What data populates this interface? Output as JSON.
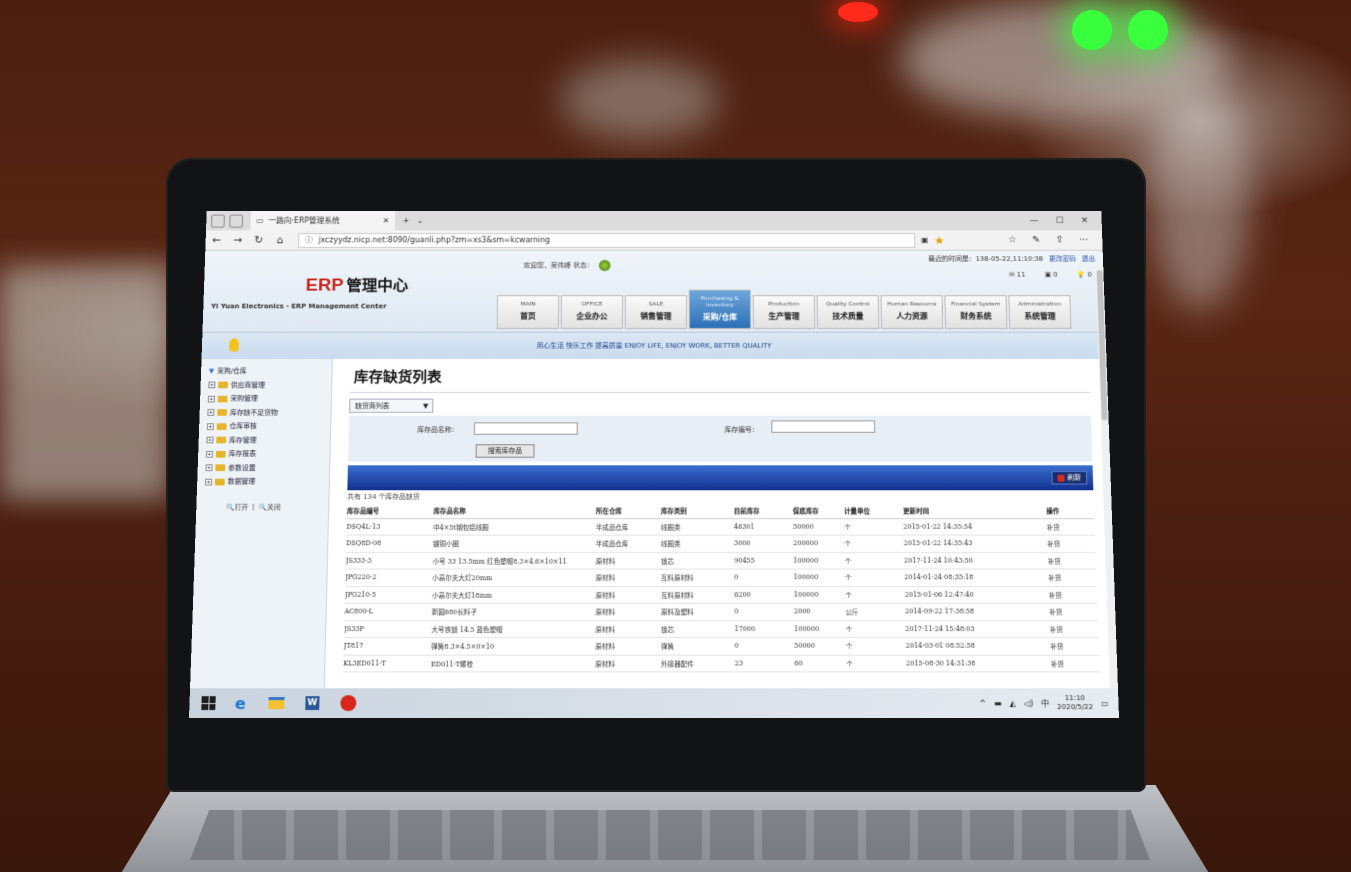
{
  "browser": {
    "tab_title": "一路向·ERP管理系统",
    "tab_close": "✕",
    "new_tab": "+",
    "url": "jxczyydz.nicp.net:8090/guanli.php?zm=xs3&sm=kcwarning"
  },
  "header": {
    "logo_main": "ERP",
    "logo_cn": "管理中心",
    "logo_sub": "Yi Yuan Electronics - ERP Management Center",
    "welcome": "欢迎您，吴伟峰 状态：",
    "login_time": "最近的时间是：138-05-22,11:10:38",
    "link1": "更改密码",
    "link2": "退出",
    "msg1": "11",
    "msg2": "0",
    "msg3": "0"
  },
  "menu": [
    {
      "en": "MAIN",
      "cn": "首页"
    },
    {
      "en": "OFFICE",
      "cn": "企业办公"
    },
    {
      "en": "SALE",
      "cn": "销售管理"
    },
    {
      "en": "Purchasing & Inventory",
      "cn": "采购/仓库"
    },
    {
      "en": "Production",
      "cn": "生产管理"
    },
    {
      "en": "Quality Control",
      "cn": "技术质量"
    },
    {
      "en": "Human Resource",
      "cn": "人力资源"
    },
    {
      "en": "Financial System",
      "cn": "财务系统"
    },
    {
      "en": "Administration",
      "cn": "系统管理"
    }
  ],
  "slogan": "用心生活 快乐工作 提高质量 ENJOY LIFE, ENJOY WORK, BETTER QUALITY",
  "sidebar": {
    "root": "采购/仓库",
    "items": [
      "供应商管理",
      "采购管理",
      "库存缺不足货物",
      "仓库审核",
      "库存管理",
      "库存报表",
      "参数设置",
      "数据管理"
    ],
    "open": "打开",
    "close": "关闭"
  },
  "page": {
    "title": "库存缺货列表",
    "select": "缺货商列表",
    "label_name": "库存品名称：",
    "label_code": "库存编号：",
    "search_btn": "搜索库存品",
    "refresh": "刷新",
    "count": "共有 134 个库存品缺货"
  },
  "table": {
    "headers": [
      "库存品编号",
      "库存品名称",
      "所在仓库",
      "库存类别",
      "目前库存",
      "保底库存",
      "计量单位",
      "更新时间",
      "操作"
    ],
    "rows": [
      [
        "DSQ4L-13",
        "中4×5t钢包铝线圈",
        "半成品仓库",
        "线圈类",
        "46301",
        "50000",
        "个",
        "2015-01-22 14:35:54",
        "补货"
      ],
      [
        "DSQ8D-08",
        "镀铜小圈",
        "半成品仓库",
        "线圈类",
        "3000",
        "200000",
        "个",
        "2015-01-22 14:35:43",
        "补货"
      ],
      [
        "JS333-3",
        "小号 33 13.5mm 红色塑帽8.3×4.6×10×11",
        "原材料",
        "锁芯",
        "90455",
        "100000",
        "个",
        "2017-11-24 10:43:50",
        "补货"
      ],
      [
        "JPG220-2",
        "小高尔夫大灯20mm",
        "原材料",
        "互料原材料",
        "0",
        "100000",
        "个",
        "2014-01-24 08:35:18",
        "补货"
      ],
      [
        "JPG210-5",
        "小高尔夫大灯18mm",
        "原材料",
        "互料原材料",
        "6200",
        "100000",
        "个",
        "2015-01-06 12:47:40",
        "补货"
      ],
      [
        "AC800-L",
        "新圆680长料子",
        "原材料",
        "原料及塑料",
        "0",
        "2000",
        "公斤",
        "2014-09-22 17:38:58",
        "补货"
      ],
      [
        "JS33P",
        "大号铁锁 14.5 蓝色塑帽",
        "原材料",
        "锁芯",
        "17000",
        "100000",
        "个",
        "2017-11-24 15:48:03",
        "补货"
      ],
      [
        "JT817",
        "弹簧8.3×4.5×0×10",
        "原材料",
        "弹簧",
        "0",
        "50000",
        "个",
        "2014-03-01 08:52:58",
        "补货"
      ],
      [
        "KL3ED011-T",
        "ED011-T螺栓",
        "原材料",
        "外接器配件",
        "23",
        "60",
        "个",
        "2015-08-30 14:31:38",
        "补货"
      ]
    ]
  },
  "taskbar": {
    "ime": "中",
    "time": "11:10",
    "date": "2020/5/22"
  }
}
